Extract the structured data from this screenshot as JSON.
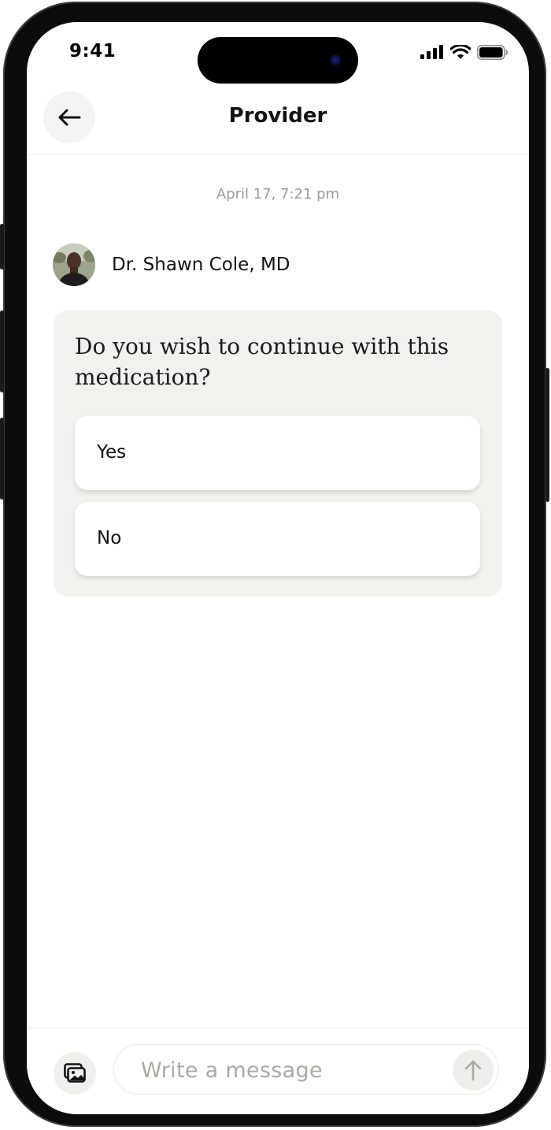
{
  "status_bar": {
    "time": "9:41"
  },
  "header": {
    "title": "Provider",
    "back_icon": "arrow-left-icon"
  },
  "conversation": {
    "timestamp": "April 17, 7:21 pm",
    "sender": {
      "name": "Dr. Shawn Cole, MD"
    },
    "question": {
      "text": "Do you wish to continue with this medication?",
      "options": [
        {
          "label": "Yes"
        },
        {
          "label": "No"
        }
      ]
    }
  },
  "composer": {
    "placeholder": "Write a message",
    "attach_icon": "photo-gallery-icon",
    "send_icon": "arrow-up-icon"
  },
  "colors": {
    "card_background": "#f1f1ed",
    "timestamp_text": "#9a9a97",
    "placeholder_text": "#a9a9a6"
  }
}
